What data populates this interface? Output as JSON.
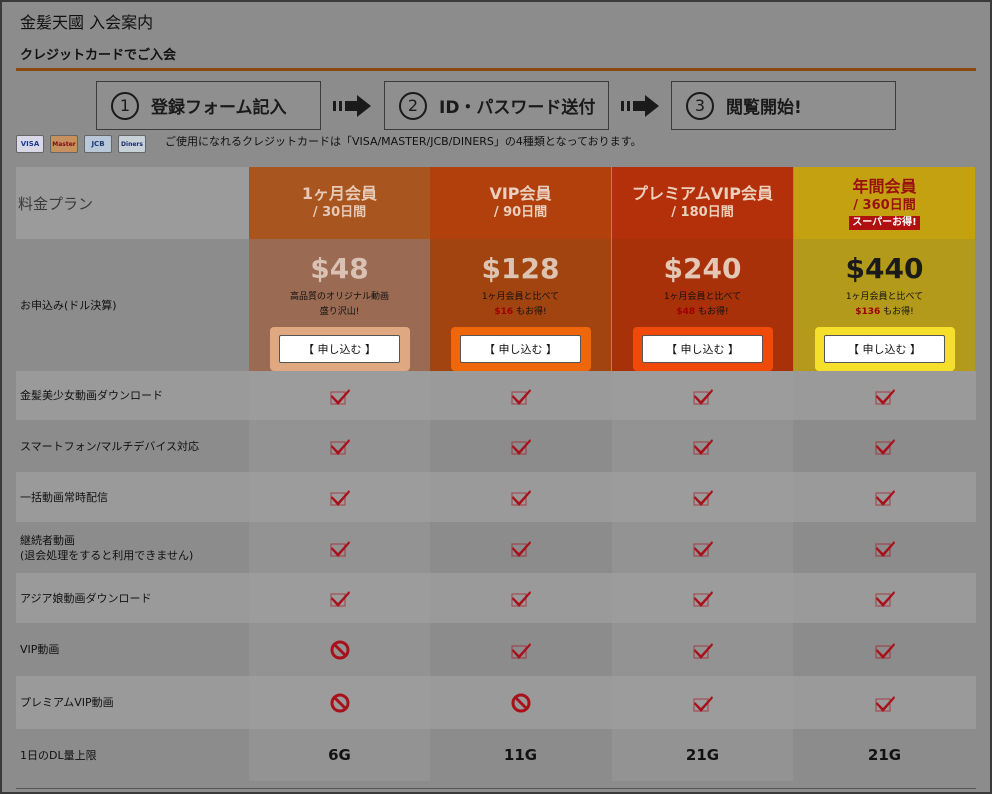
{
  "header": {
    "title": "金髪天國 入会案内",
    "subtitle": "クレジットカードでご入会"
  },
  "steps": [
    {
      "num": "1",
      "label": "登録フォーム記入"
    },
    {
      "num": "2",
      "label": "ID・パスワード送付"
    },
    {
      "num": "3",
      "label": "閲覧開始!"
    }
  ],
  "cards": {
    "items": [
      "VISA",
      "Master",
      "JCB",
      "Diners"
    ],
    "note": "ご使用になれるクレジットカードは「VISA/MASTER/JCB/DINERS」の4種類となっております。"
  },
  "table": {
    "plan_header_label": "料金プラン",
    "price_label": "お申込み(ドル決算)",
    "plans": [
      {
        "name": "1ヶ月会員",
        "days": "/ 30日間",
        "badge": "",
        "price": "$48",
        "desc1": "高品質のオリジナル動画",
        "desc2": "盛り沢山!",
        "save": "",
        "save_suffix": "",
        "button": "【 申し込む 】",
        "head_color": "#a8551f",
        "body_color": "#9a6a52",
        "btn_bg": "#e0a880",
        "price_color": "#d9c1b4",
        "name_color": "#e7c9b8"
      },
      {
        "name": "VIP会員",
        "days": "/ 90日間",
        "badge": "",
        "price": "$128",
        "desc1": "1ヶ月会員と比べて",
        "desc2": "",
        "save": "$16",
        "save_suffix": "もお得!",
        "button": "【 申し込む 】",
        "head_color": "#b2400c",
        "body_color": "#a14410",
        "btn_bg": "#f0660a",
        "price_color": "#ddc3b2",
        "name_color": "#ead0c0"
      },
      {
        "name": "プレミアムVIP会員",
        "days": "/ 180日間",
        "badge": "",
        "price": "$240",
        "desc1": "1ヶ月会員と比べて",
        "desc2": "",
        "save": "$48",
        "save_suffix": "もお得!",
        "button": "【 申し込む 】",
        "head_color": "#b4300a",
        "body_color": "#a8310a",
        "btn_bg": "#f04a0a",
        "price_color": "#e2c8b5",
        "name_color": "#ecd0bc"
      },
      {
        "name": "年間会員",
        "days": "/ 360日間",
        "badge": "スーパーお得!",
        "price": "$440",
        "desc1": "1ヶ月会員と比べて",
        "desc2": "",
        "save": "$136",
        "save_suffix": "もお得!",
        "button": "【 申し込む 】",
        "head_color": "#c4a110",
        "body_color": "#b39a1a",
        "btn_bg": "#f6df2a",
        "price_color": "#1a1a1a",
        "name_color": "#9a1010"
      }
    ],
    "features": [
      {
        "label": "金髪美少女動画ダウンロード",
        "values": [
          "check",
          "check",
          "check",
          "check"
        ]
      },
      {
        "label": "スマートフォン/マルチデバイス対応",
        "values": [
          "check",
          "check",
          "check",
          "check"
        ]
      },
      {
        "label": "一括動画常時配信",
        "values": [
          "check",
          "check",
          "check",
          "check"
        ]
      },
      {
        "label": "継続者動画",
        "label2": "(退会処理をすると利用できません)",
        "values": [
          "check",
          "check",
          "check",
          "check"
        ]
      },
      {
        "label": "アジア娘動画ダウンロード",
        "values": [
          "check",
          "check",
          "check",
          "check"
        ]
      },
      {
        "label": "VIP動画",
        "values": [
          "no",
          "check",
          "check",
          "check"
        ]
      },
      {
        "label": "プレミアムVIP動画",
        "values": [
          "no",
          "no",
          "check",
          "check"
        ]
      },
      {
        "label": "1日のDL量上限",
        "values": [
          "6G",
          "11G",
          "21G",
          "21G"
        ]
      }
    ]
  },
  "colors": {
    "check": "#a8101a",
    "no": "#a8101a",
    "column_shade": "#9e9e9e"
  }
}
